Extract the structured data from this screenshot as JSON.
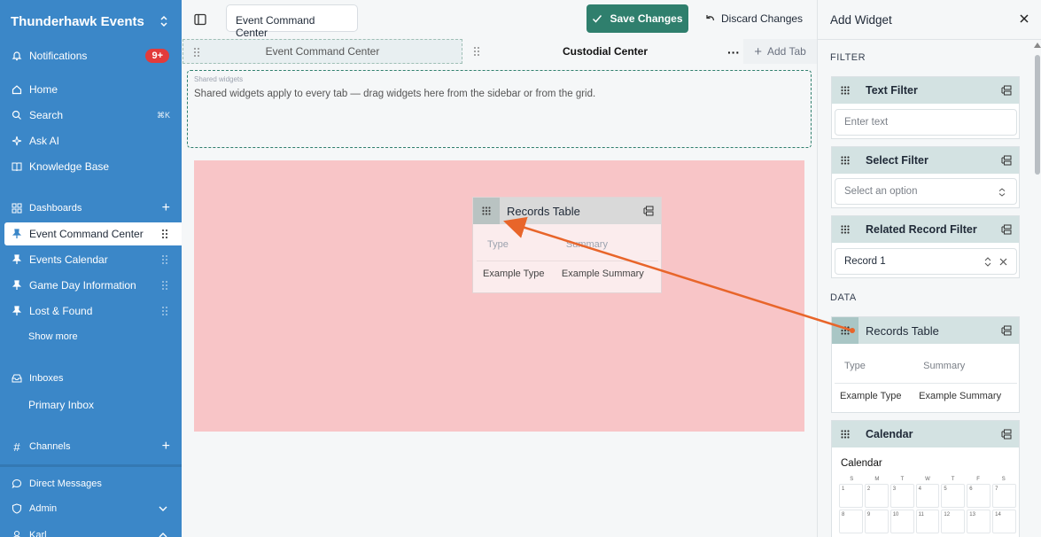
{
  "sidebar": {
    "workspace": "Thunderhawk Events",
    "notifications": {
      "label": "Notifications",
      "badge": "9+"
    },
    "nav": [
      {
        "label": "Home"
      },
      {
        "label": "Search",
        "shortcut": "⌘K"
      },
      {
        "label": "Ask AI"
      },
      {
        "label": "Knowledge Base"
      }
    ],
    "dashboards": {
      "label": "Dashboards",
      "items": [
        {
          "label": "Event Command Center"
        },
        {
          "label": "Events Calendar"
        },
        {
          "label": "Game Day Information"
        },
        {
          "label": "Lost & Found"
        }
      ],
      "show_more": "Show more"
    },
    "inboxes": {
      "label": "Inboxes",
      "items": [
        "Primary Inbox"
      ]
    },
    "channels": "Channels",
    "direct_messages": "Direct Messages",
    "admin": "Admin",
    "user": "Karl"
  },
  "toolbar": {
    "title_value": "Event Command Center",
    "save_label": "Save Changes",
    "discard_label": "Discard Changes"
  },
  "tabs": {
    "items": [
      "Event Command Center",
      "Custodial Center"
    ],
    "add_label": "Add Tab"
  },
  "shared": {
    "label": "Shared widgets",
    "text": "Shared widgets apply to every tab — drag widgets here from the sidebar or from the grid."
  },
  "dragging_widget": {
    "title": "Records Table",
    "columns": [
      "Type",
      "Summary"
    ],
    "row": [
      "Example Type",
      "Example Summary"
    ]
  },
  "panel": {
    "title": "Add Widget",
    "filter_section": "FILTER",
    "data_section": "DATA",
    "text_filter": {
      "title": "Text Filter",
      "placeholder": "Enter text"
    },
    "select_filter": {
      "title": "Select Filter",
      "placeholder": "Select an option"
    },
    "related_filter": {
      "title": "Related Record Filter",
      "value": "Record 1"
    },
    "records_table": {
      "title": "Records Table",
      "columns": [
        "Type",
        "Summary"
      ],
      "row": [
        "Example Type",
        "Example Summary"
      ]
    },
    "calendar": {
      "title": "Calendar",
      "subtitle": "Calendar",
      "dows": [
        "S",
        "M",
        "T",
        "W",
        "T",
        "F",
        "S"
      ],
      "days": [
        "1",
        "2",
        "3",
        "4",
        "5",
        "6",
        "7",
        "8",
        "9",
        "10",
        "11",
        "12",
        "13",
        "14"
      ]
    }
  },
  "colors": {
    "sidebar": "#3b87c8",
    "accent": "#2f7f6d",
    "drop_zone": "#f8c5c7",
    "arrow": "#e8652a",
    "badge": "#e23b3b"
  }
}
